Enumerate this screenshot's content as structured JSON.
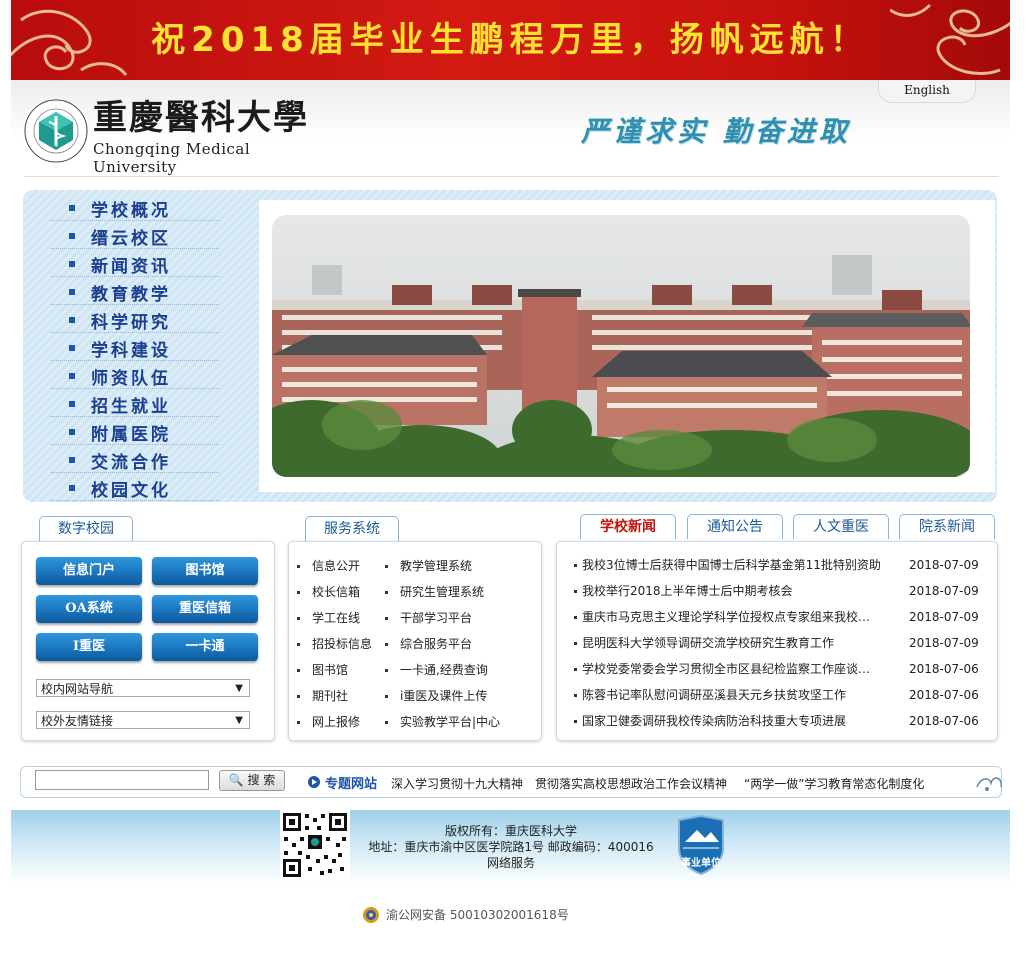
{
  "banner": {
    "text": "祝2018届毕业生鹏程万里，扬帆远航！"
  },
  "header": {
    "english_link": "English",
    "logo_cn": "重慶醫科大學",
    "logo_en": "Chongqing Medical University",
    "motto": "严谨求实  勤奋进取"
  },
  "nav": {
    "items": [
      "学校概况",
      "缙云校区",
      "新闻资讯",
      "教育教学",
      "科学研究",
      "学科建设",
      "师资队伍",
      "招生就业",
      "附属医院",
      "交流合作",
      "校园文化"
    ]
  },
  "digital_campus": {
    "tab": "数字校园",
    "buttons": [
      "信息门户",
      "图书馆",
      "OA系统",
      "重医信箱",
      "I重医",
      "一卡通"
    ],
    "select_internal": "校内网站导航",
    "select_external": "校外友情链接"
  },
  "services": {
    "tab": "服务系统",
    "left": [
      "信息公开",
      "校长信箱",
      "学工在线",
      "招投标信息",
      "图书馆",
      "期刊社",
      "网上报修"
    ],
    "right": [
      "教学管理系统",
      "研究生管理系统",
      "干部学习平台",
      "综合服务平台",
      "一卡通,经费查询",
      "i重医及课件上传",
      "实验教学平台|中心"
    ]
  },
  "news": {
    "tabs": [
      "学校新闻",
      "通知公告",
      "人文重医",
      "院系新闻"
    ],
    "items": [
      {
        "title": "我校3位博士后获得中国博士后科学基金第11批特别资助",
        "date": "2018-07-09"
      },
      {
        "title": "我校举行2018上半年博士后中期考核会",
        "date": "2018-07-09"
      },
      {
        "title": "重庆市马克思主义理论学科学位授权点专家组来我校开展评估",
        "date": "2018-07-09"
      },
      {
        "title": "昆明医科大学领导调研交流学校研究生教育工作",
        "date": "2018-07-09"
      },
      {
        "title": "学校党委常委会学习贯彻全市区县纪检监察工作座谈会精神",
        "date": "2018-07-06"
      },
      {
        "title": "陈蓉书记率队慰问调研巫溪县天元乡扶贫攻坚工作",
        "date": "2018-07-06"
      },
      {
        "title": "国家卫健委调研我校传染病防治科技重大专项进展",
        "date": "2018-07-06"
      }
    ]
  },
  "search": {
    "button": "搜 索",
    "special_label": "专题网站",
    "special_links": [
      "深入学习贯彻十九大精神",
      "贯彻落实高校思想政治工作会议精神",
      "“两学一做”学习教育常态化制度化"
    ]
  },
  "footer": {
    "copyright": "版权所有：重庆医科大学",
    "address": "地址：重庆市渝中区医学院路1号 邮政编码：400016",
    "service": "网络服务",
    "badge": "事业单位",
    "beian": "渝公网安备 50010302001618号"
  },
  "colors": {
    "banner_red": "#c8120d",
    "banner_text": "#ffe232",
    "nav_blue": "#1a3f8f",
    "active_tab_red": "#c0140e",
    "link_blue": "#1c5a9a"
  }
}
